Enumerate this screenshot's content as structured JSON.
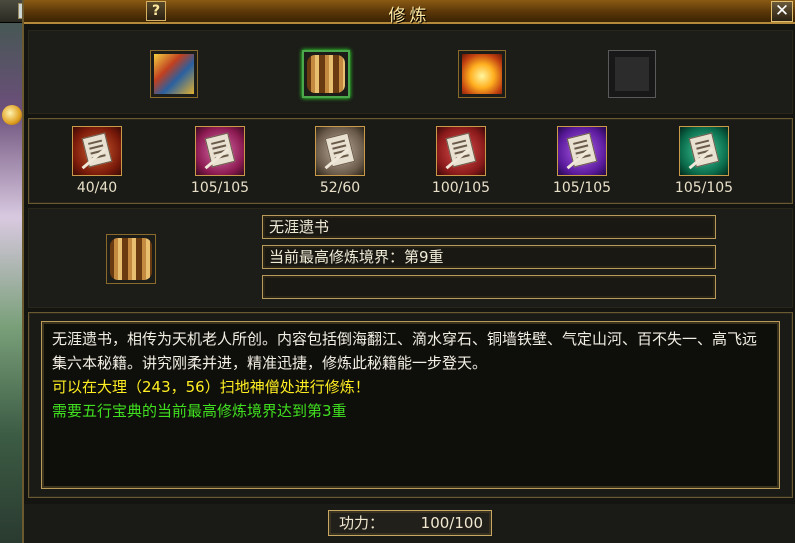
{
  "window": {
    "title": "修炼",
    "help_label": "?",
    "close_label": "✕"
  },
  "top_slots": [
    {
      "icon": "colorful-book-icon",
      "selected": false
    },
    {
      "icon": "scroll-bundle-icon",
      "selected": true
    },
    {
      "icon": "treasure-chest-icon",
      "selected": false
    },
    {
      "icon": "empty-slot",
      "selected": false
    }
  ],
  "skills": [
    {
      "icon": "red-scroll-icon",
      "count": "40/40"
    },
    {
      "icon": "pink-scroll-icon",
      "count": "105/105"
    },
    {
      "icon": "gray-scroll-icon",
      "count": "52/60"
    },
    {
      "icon": "crimson-scroll-icon",
      "count": "100/105"
    },
    {
      "icon": "purple-scroll-icon",
      "count": "105/105"
    },
    {
      "icon": "teal-scroll-icon",
      "count": "105/105"
    }
  ],
  "detail": {
    "icon": "scroll-bundle-icon",
    "name": "无涯遗书",
    "level": "当前最高修炼境界：第9重",
    "extra": ""
  },
  "description": {
    "text": "无涯遗书，相传为天机老人所创。内容包括倒海翻江、滴水穿石、铜墙铁壁、气定山河、百不失一、高飞远集六本秘籍。讲究刚柔并进，精准迅捷，修炼此秘籍能一步登天。",
    "location": "可以在大理（243，56）扫地神僧处进行修炼！",
    "requirement": "需要五行宝典的当前最高修炼境界达到第3重"
  },
  "footer": {
    "power_label": "功力：",
    "power_value": "100/100"
  },
  "colors": {
    "yellow_text": "#ffee22",
    "green_text": "#40e020",
    "frame_gold": "#b89a5a"
  }
}
